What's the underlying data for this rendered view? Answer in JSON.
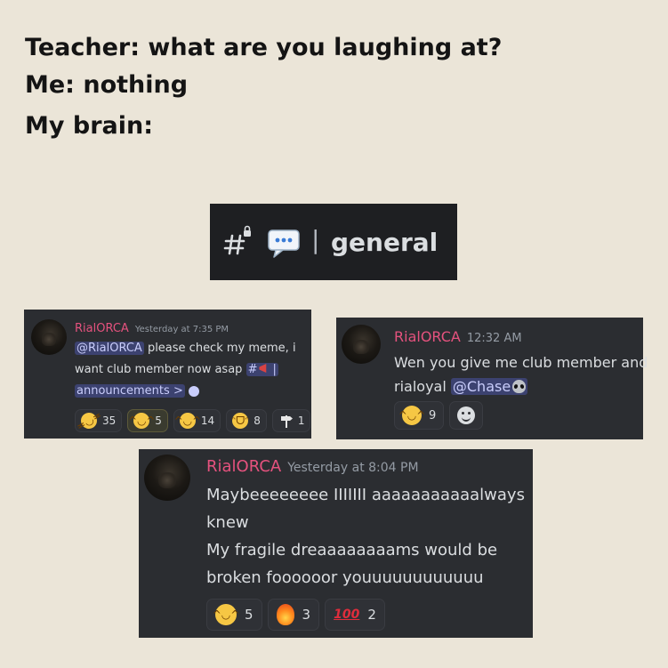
{
  "caption": {
    "line1": "Teacher: what are you laughing at?",
    "line2": "Me: nothing",
    "line3": "My brain:"
  },
  "channel_header": {
    "hash_icon": "locked-hash-icon",
    "chat_icon": "speech-bubble-icon",
    "separator": "|",
    "name": "general"
  },
  "messages": [
    {
      "author": "RialORCA",
      "timestamp": "Yesterday at 7:35 PM",
      "mention": "@RialORCA",
      "text_part1": " please check my meme, i",
      "text_part2": "want club member now asap ",
      "channel_mention_prefix": "#",
      "channel_mention_sep": "|",
      "channel_mention_name": "announcements",
      "channel_mention_suffix": ">",
      "reactions": [
        {
          "icon": "rolling-laughing-emoji",
          "count": "35"
        },
        {
          "icon": "tears-of-joy-emoji",
          "count": "5",
          "active": true
        },
        {
          "icon": "tears-of-joy-emoji",
          "count": "14"
        },
        {
          "icon": "grinning-emoji",
          "count": "8"
        },
        {
          "icon": "arrow-signpost-emoji",
          "count": "1"
        }
      ]
    },
    {
      "author": "RialORCA",
      "timestamp": "12:32 AM",
      "text_line1": "Wen you give me club member and",
      "text_line2_prefix": "rialoyal ",
      "mention": "@Chase",
      "mention_icon": "alien-emoji",
      "reactions": [
        {
          "icon": "tears-of-joy-emoji",
          "count": "9"
        },
        {
          "icon": "add-reaction-icon",
          "count": ""
        }
      ]
    },
    {
      "author": "RialORCA",
      "timestamp": "Yesterday at 8:04 PM",
      "lines": [
        "Maybeeeeeeee IIIIIII aaaaaaaaaaalways",
        "knew",
        "My fragile dreaaaaaaaams would be",
        "broken foooooor youuuuuuuuuuuu"
      ],
      "reactions": [
        {
          "icon": "tears-of-joy-emoji",
          "count": "5"
        },
        {
          "icon": "fire-emoji",
          "count": "3"
        },
        {
          "icon": "hundred-points-emoji",
          "label": "100",
          "count": "2"
        }
      ]
    }
  ],
  "colors": {
    "background": "#ebe5d8",
    "card": "#2b2d31",
    "author": "#e5527e",
    "mention_bg": "#3c4270"
  }
}
